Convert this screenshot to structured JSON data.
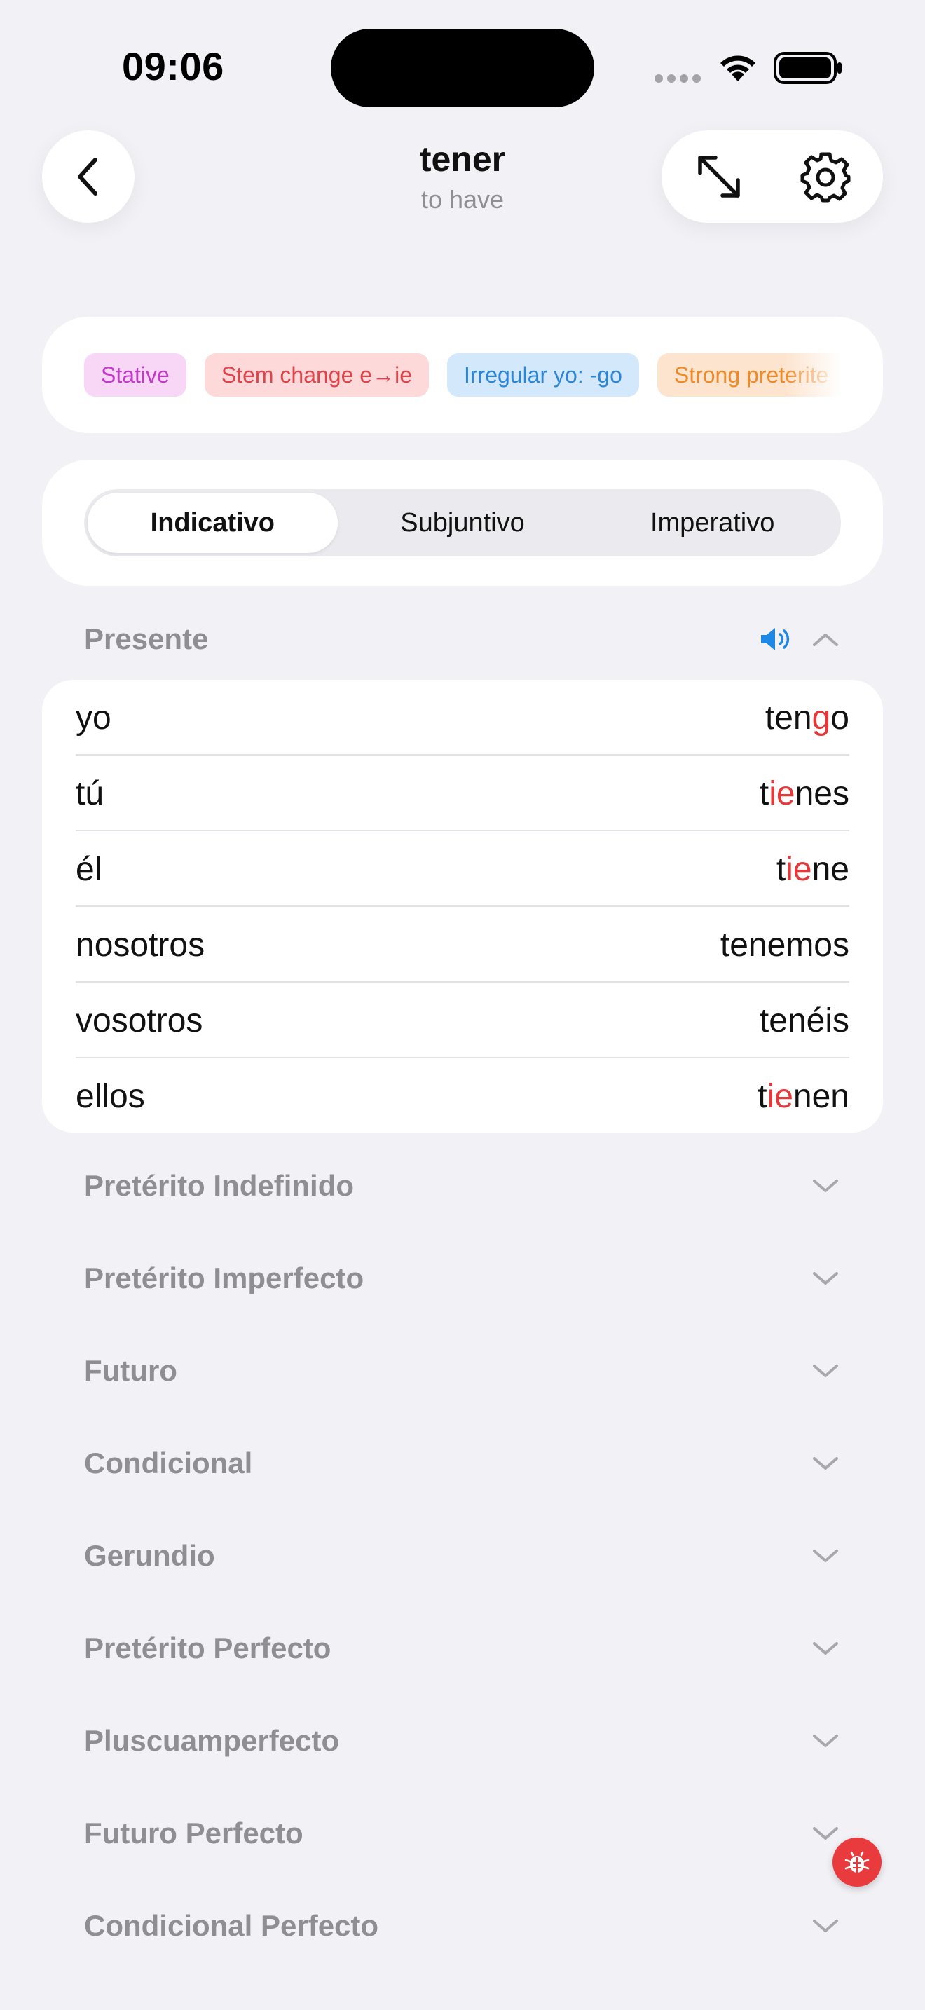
{
  "status_bar": {
    "time": "09:06"
  },
  "header": {
    "title": "tener",
    "subtitle": "to have",
    "back_icon": "chevron-left-icon",
    "expand_icon": "expand-arrows-icon",
    "settings_icon": "gear-icon"
  },
  "tags": [
    {
      "label": "Stative",
      "bg": "#F8D7F6",
      "color": "#C23BC7"
    },
    {
      "label": "Stem change e→ie",
      "bg": "#FDD9DA",
      "color": "#E0444B"
    },
    {
      "label": "Irregular yo: -go",
      "bg": "#D3E8FA",
      "color": "#2B86D8"
    },
    {
      "label": "Strong preterite",
      "bg": "#FDE4CF",
      "color": "#EE8A2A"
    }
  ],
  "moods": [
    {
      "label": "Indicativo",
      "active": true
    },
    {
      "label": "Subjuntivo",
      "active": false
    },
    {
      "label": "Imperativo",
      "active": false
    }
  ],
  "open_tense": {
    "title": "Presente",
    "speaker_icon": "speaker-icon",
    "collapse_icon": "chevron-up-icon",
    "rows": [
      {
        "pronoun": "yo",
        "form": [
          [
            "ten",
            false
          ],
          [
            "g",
            true
          ],
          [
            "o",
            false
          ]
        ]
      },
      {
        "pronoun": "tú",
        "form": [
          [
            "t",
            false
          ],
          [
            "ie",
            true
          ],
          [
            "nes",
            false
          ]
        ]
      },
      {
        "pronoun": "él",
        "form": [
          [
            "t",
            false
          ],
          [
            "ie",
            true
          ],
          [
            "ne",
            false
          ]
        ]
      },
      {
        "pronoun": "nosotros",
        "form": [
          [
            "tenemos",
            false
          ]
        ]
      },
      {
        "pronoun": "vosotros",
        "form": [
          [
            "tenéis",
            false
          ]
        ]
      },
      {
        "pronoun": "ellos",
        "form": [
          [
            "t",
            false
          ],
          [
            "ie",
            true
          ],
          [
            "nen",
            false
          ]
        ]
      }
    ]
  },
  "collapsed_tenses": [
    "Pretérito Indefinido",
    "Pretérito Imperfecto",
    "Futuro",
    "Condicional",
    "Gerundio",
    "Pretérito Perfecto",
    "Pluscuamperfecto",
    "Futuro Perfecto",
    "Condicional Perfecto"
  ],
  "colors": {
    "accent_blue": "#1E88E5",
    "highlight_red": "#E5383B",
    "muted_gray": "#8E8E93",
    "background": "#F1F1F6"
  },
  "debug_button_icon": "ladybug-icon"
}
